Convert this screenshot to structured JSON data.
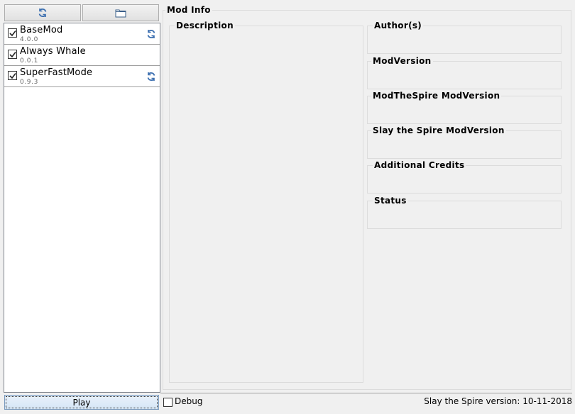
{
  "toolbar": {
    "refresh_icon": "refresh-icon",
    "folder_icon": "folder-icon"
  },
  "mods": [
    {
      "name": "BaseMod",
      "version": "4.0.0",
      "checked": true,
      "update_available": true
    },
    {
      "name": "Always Whale",
      "version": "0.0.1",
      "checked": true,
      "update_available": false
    },
    {
      "name": "SuperFastMode",
      "version": "0.9.3",
      "checked": true,
      "update_available": true
    }
  ],
  "mod_info": {
    "title": "Mod Info",
    "description_label": "Description",
    "authors_label": "Author(s)",
    "mod_version_label": "ModVersion",
    "mts_version_label": "ModTheSpire ModVersion",
    "sts_version_label": "Slay the Spire ModVersion",
    "credits_label": "Additional Credits",
    "status_label": "Status"
  },
  "footer": {
    "play_label": "Play",
    "debug_label": "Debug",
    "debug_checked": false,
    "game_version_label": "Slay the Spire version: 10-11-2018"
  },
  "colors": {
    "background": "#f0f0f0",
    "list_background": "#ffffff",
    "update_icon": "#3c6fb0"
  }
}
